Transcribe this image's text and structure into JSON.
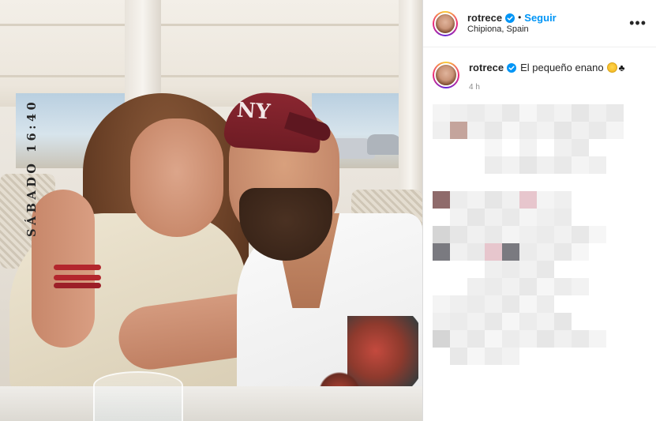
{
  "post": {
    "username": "rotrece",
    "follow_label": "Seguir",
    "separator": "•",
    "location": "Chipiona, Spain",
    "more_label": "•••",
    "caption_username": "rotrece",
    "caption_text": "El pequeño enano",
    "caption_suffix": "♣",
    "time_ago": "4 h",
    "photo_overlay_text": "SÁBADO 16:40",
    "cap_logo": "NY",
    "verified_color": "#0095f6",
    "accent_follow_color": "#0095f6"
  },
  "icons": {
    "verified": "verified-badge-icon",
    "more": "more-options-icon",
    "emoji": "smiling-face-emoji",
    "spade": "spade-suit-emoji"
  }
}
